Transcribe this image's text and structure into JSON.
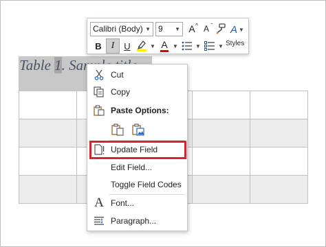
{
  "document": {
    "caption_prefix": "Table ",
    "caption_field": "1",
    "caption_suffix": ". Sample title"
  },
  "mini_toolbar": {
    "font_name": "Calibri (Body)",
    "font_size": "9",
    "grow_font": "A",
    "shrink_font": "A",
    "bold": "B",
    "italic": "I",
    "underline": "U",
    "font_color_letter": "A",
    "styles_glyph": "A",
    "styles_label": "Styles",
    "highlight_color": "#ffef00",
    "font_color": "#e00000"
  },
  "context_menu": {
    "cut": "Cut",
    "copy": "Copy",
    "paste_options": "Paste Options:",
    "update_field": "Update Field",
    "edit_field": "Edit Field...",
    "toggle_field_codes": "Toggle Field Codes",
    "font": "Font...",
    "paragraph": "Paragraph...",
    "font_icon_glyph": "A"
  },
  "annotation": {
    "highlight_color": "#d9232d"
  }
}
